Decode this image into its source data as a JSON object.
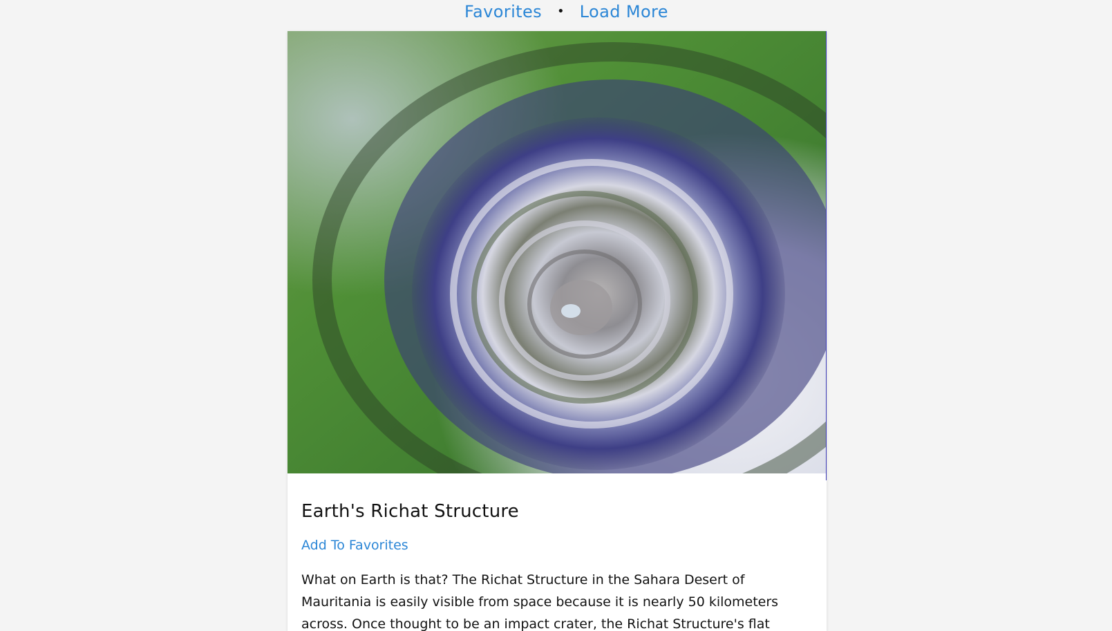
{
  "nav": {
    "favorites_label": "Favorites",
    "separator": "•",
    "load_more_label": "Load More"
  },
  "card": {
    "title": "Earth's Richat Structure",
    "add_favorites_label": "Add To Favorites",
    "description": "What on Earth is that? The Richat Structure in the Sahara Desert of Mauritania is easily visible from space because it is nearly 50 kilometers across. Once thought to be an impact crater, the Richat Structure's flat middle and lack of"
  },
  "colors": {
    "accent": "#2b86d6",
    "page_background": "#f4f4f4",
    "card_background": "#ffffff"
  }
}
